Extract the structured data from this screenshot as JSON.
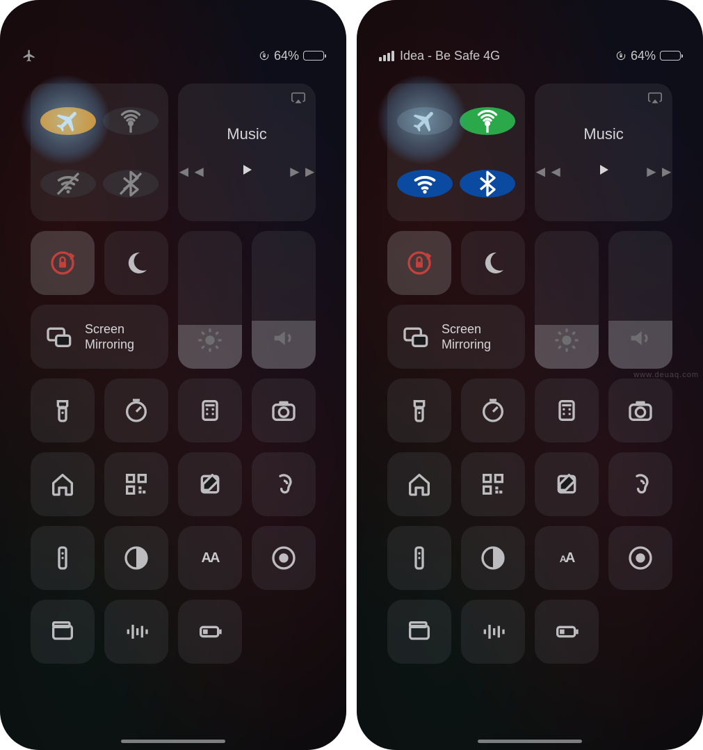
{
  "watermark": "www.deuaq.com",
  "left": {
    "status": {
      "airplane": true,
      "carrier": "",
      "lock_icon": true,
      "battery_text": "64%",
      "battery_pct": 64
    },
    "conn": {
      "airplane": {
        "active": true
      },
      "cellular": {
        "active": false
      },
      "wifi": {
        "active": false
      },
      "bluetooth": {
        "active": false
      }
    },
    "music": {
      "label": "Music"
    },
    "mirror": {
      "line1": "Screen",
      "line2": "Mirroring"
    },
    "brightness_pct": 32,
    "volume_pct": 35,
    "text_size_label": "AA"
  },
  "right": {
    "status": {
      "airplane": false,
      "carrier": "Idea - Be Safe 4G",
      "lock_icon": true,
      "battery_text": "64%",
      "battery_pct": 64
    },
    "conn": {
      "airplane": {
        "active": false
      },
      "cellular": {
        "active": true
      },
      "wifi": {
        "active": true
      },
      "bluetooth": {
        "active": true
      }
    },
    "music": {
      "label": "Music"
    },
    "mirror": {
      "line1": "Screen",
      "line2": "Mirroring"
    },
    "brightness_pct": 32,
    "volume_pct": 35,
    "text_size_label": "AA"
  }
}
